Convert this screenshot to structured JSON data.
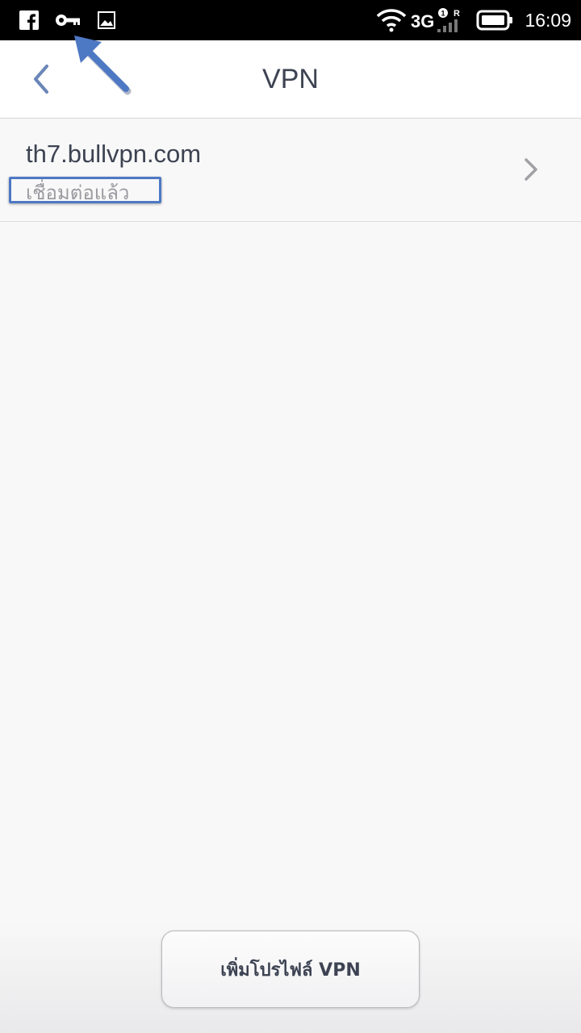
{
  "status_bar": {
    "time": "16:09",
    "network": "3G",
    "sim_badge": "1R",
    "icons": [
      "facebook-icon",
      "vpn-key-icon",
      "image-icon",
      "wifi-icon",
      "signal-icon",
      "battery-icon"
    ]
  },
  "header": {
    "title": "VPN",
    "back_icon": "chevron-left-icon"
  },
  "vpn_list": [
    {
      "name": "th7.bullvpn.com",
      "status": "เชื่อมต่อแล้ว"
    }
  ],
  "footer": {
    "add_button_label": "เพิ่มโปรไฟล์ VPN"
  },
  "colors": {
    "accent": "#6b86b8",
    "annotation": "#4d78c4",
    "text_primary": "#3d4352",
    "text_secondary": "#9a9aa0",
    "background": "#f8f8f8"
  }
}
